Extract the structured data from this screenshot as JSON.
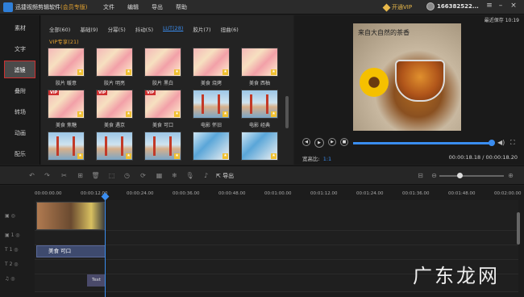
{
  "app": {
    "title": "迅捷视频剪辑软件",
    "edition": "(会员专版)",
    "menu": [
      "文件",
      "编辑",
      "导出",
      "帮助"
    ],
    "vip_button": "开通VIP",
    "user_name": "166382522..."
  },
  "sidebar": {
    "items": [
      {
        "label": "素材"
      },
      {
        "label": "文字"
      },
      {
        "label": "滤镜",
        "active": true
      },
      {
        "label": "叠附"
      },
      {
        "label": "转场"
      },
      {
        "label": "动画"
      },
      {
        "label": "配乐"
      }
    ]
  },
  "filters": {
    "tabs": [
      {
        "label": "全部(60)"
      },
      {
        "label": "基础(9)"
      },
      {
        "label": "分幂(5)"
      },
      {
        "label": "抖动(5)"
      },
      {
        "label": "LUT(28)",
        "active": true
      },
      {
        "label": "胶片(7)"
      },
      {
        "label": "扭曲(6)"
      }
    ],
    "section_label": "VIP专享(21)",
    "items": [
      {
        "label": "胶片 暖意",
        "scene": "flower",
        "vip": false
      },
      {
        "label": "胶片 明亮",
        "scene": "flower",
        "vip": false
      },
      {
        "label": "胶片 黑白",
        "scene": "flower",
        "vip": false
      },
      {
        "label": "美食 烧烤",
        "scene": "flower",
        "vip": false
      },
      {
        "label": "美食 西柚",
        "scene": "flower",
        "vip": false
      },
      {
        "label": "美食 焦糖",
        "scene": "flower",
        "vip": true
      },
      {
        "label": "美食 遇京",
        "scene": "flower",
        "vip": true
      },
      {
        "label": "美食 可口",
        "scene": "flower",
        "vip": true
      },
      {
        "label": "电影 怀旧",
        "scene": "bridge",
        "vip": false
      },
      {
        "label": "电影 经典",
        "scene": "bridge",
        "vip": false
      },
      {
        "label": "",
        "scene": "bridge",
        "vip": false
      },
      {
        "label": "",
        "scene": "bridge",
        "vip": false
      },
      {
        "label": "",
        "scene": "bridge",
        "vip": false
      },
      {
        "label": "",
        "scene": "girl",
        "vip": false
      },
      {
        "label": "",
        "scene": "girl",
        "vip": false
      }
    ]
  },
  "preview": {
    "last_saved": "最近保存 10:19",
    "caption": "来自大自然的茶香",
    "aspect_label": "宽高比:",
    "aspect_value": "1:1",
    "timecode": "00:00:18.18 / 00:00:18.20",
    "progress": 0.98
  },
  "toolbar": {
    "export_label": "导出"
  },
  "timeline": {
    "ruler": [
      "00:00:00.00",
      "00:00:12.00",
      "00:00:24.00",
      "00:00:36.00",
      "00:00:48.00",
      "00:01:00.00",
      "00:01:12.00",
      "00:01:24.00",
      "00:01:36.00",
      "00:01:48.00",
      "00:02:00.00"
    ],
    "title_clip": "美食 可口",
    "text_clip": "Text"
  },
  "watermark": "广东龙网"
}
